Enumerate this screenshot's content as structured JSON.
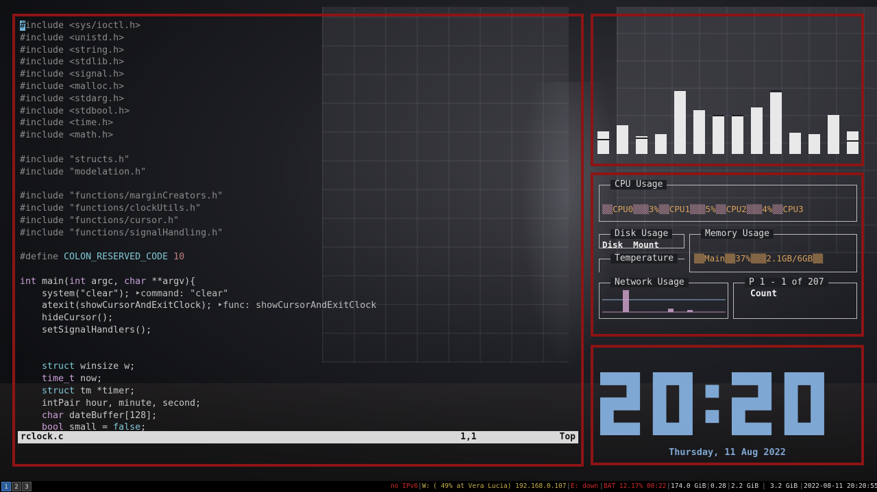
{
  "editor": {
    "lines": [
      [
        [
          "pp",
          "#include <sys/ioctl.h>"
        ]
      ],
      [
        [
          "pp",
          "#include <unistd.h>"
        ]
      ],
      [
        [
          "pp",
          "#include <string.h>"
        ]
      ],
      [
        [
          "pp",
          "#include <stdlib.h>"
        ]
      ],
      [
        [
          "pp",
          "#include <signal.h>"
        ]
      ],
      [
        [
          "pp",
          "#include <malloc.h>"
        ]
      ],
      [
        [
          "pp",
          "#include <stdarg.h>"
        ]
      ],
      [
        [
          "pp",
          "#include <stdbool.h>"
        ]
      ],
      [
        [
          "pp",
          "#include <time.h>"
        ]
      ],
      [
        [
          "pp",
          "#include <math.h>"
        ]
      ],
      [],
      [
        [
          "pp",
          "#include \"structs.h\""
        ]
      ],
      [
        [
          "pp",
          "#include \"modelation.h\""
        ]
      ],
      [],
      [
        [
          "pp",
          "#include \"functions/marginCreators.h\""
        ]
      ],
      [
        [
          "pp",
          "#include \"functions/clockUtils.h\""
        ]
      ],
      [
        [
          "pp",
          "#include \"functions/cursor.h\""
        ]
      ],
      [
        [
          "pp",
          "#include \"functions/signalHandling.h\""
        ]
      ],
      [],
      [
        [
          "pp",
          "#define "
        ],
        [
          "def",
          "COLON_RESERVED_CODE "
        ],
        [
          "num",
          "10"
        ]
      ],
      [],
      [
        [
          "ty",
          "int"
        ],
        [
          "str",
          " main("
        ],
        [
          "ty",
          "int"
        ],
        [
          "str",
          " argc, "
        ],
        [
          "ty",
          "char"
        ],
        [
          "str",
          " **argv){"
        ]
      ],
      [
        [
          "str",
          "    system("
        ],
        [
          "str",
          "\"clear\""
        ],
        [
          "str",
          "); "
        ],
        [
          "hint",
          "‣command: \"clear\""
        ]
      ],
      [
        [
          "str",
          "    atexit(showCursorAndExitClock); "
        ],
        [
          "hint",
          "‣func: showCursorAndExitClock"
        ]
      ],
      [
        [
          "str",
          "    hideCursor();"
        ]
      ],
      [
        [
          "str",
          "    setSignalHandlers();"
        ]
      ],
      [],
      [],
      [
        [
          "kw",
          "    struct"
        ],
        [
          "str",
          " winsize w;"
        ]
      ],
      [
        [
          "ty",
          "    time_t"
        ],
        [
          "str",
          " now;"
        ]
      ],
      [
        [
          "kw",
          "    struct"
        ],
        [
          "str",
          " tm *timer;"
        ]
      ],
      [
        [
          "str",
          "    intPair hour, minute, second;"
        ]
      ],
      [
        [
          "ty",
          "    char"
        ],
        [
          "str",
          " dateBuffer[128];"
        ]
      ],
      [
        [
          "ty",
          "    bool"
        ],
        [
          "str",
          " small = "
        ],
        [
          "kw",
          "false"
        ],
        [
          "str",
          ";"
        ]
      ]
    ],
    "filename": "rclock.c",
    "position": "1,1",
    "scroll": "Top"
  },
  "visualizer": {
    "levels": [
      0.3,
      0.38,
      0.24,
      0.26,
      0.84,
      0.58,
      0.52,
      0.52,
      0.62,
      0.82,
      0.28,
      0.26,
      0.52,
      0.3
    ],
    "caps": [
      0.18,
      null,
      0.2,
      null,
      null,
      null,
      0.5,
      0.5,
      null,
      0.83,
      null,
      null,
      null,
      0.16
    ]
  },
  "monitor": {
    "cpu": {
      "title": "CPU Usage",
      "items": [
        {
          "name": "CPU0",
          "pct": "3%"
        },
        {
          "name": "CPU1",
          "pct": "5%"
        },
        {
          "name": "CPU2",
          "pct": "4%"
        },
        {
          "name": "CPU3",
          "pct": ""
        }
      ]
    },
    "disk": {
      "title": "Disk Usage",
      "col1": "Disk",
      "col2": "Mount"
    },
    "memory": {
      "title": "Memory Usage",
      "line": "▒▒Main▒▒37%▒▒▒2.1GB/6GB▒▒"
    },
    "temperature": {
      "title": "Temperature"
    },
    "network": {
      "title": "Network Usage"
    },
    "processes": {
      "title": "P 1 - 1 of 207",
      "column": "Count"
    }
  },
  "clock": {
    "time": "20:20",
    "date": "Thursday, 11 Aug 2022"
  },
  "bar": {
    "workspaces": [
      "1",
      "2",
      "3"
    ],
    "active_workspace": "1",
    "ipv6": "no IPv6",
    "wifi_label": "W:",
    "wifi": "( 49% at Vera Lucia) 192.168.0.107",
    "eth": "E: down",
    "battery": "BAT 12.17% 00:22",
    "disk": "174.0 GiB",
    "load": "0.28",
    "mem_used": "2.2 GiB",
    "mem_avail": "3.2 GiB",
    "datetime": "2022-08-11 20:20:55"
  },
  "colors": {
    "frame": "#8d1414",
    "clock_digits": "#7fa7d3",
    "cpu_name": "#d9a05a",
    "net_line": "#8fb0d8",
    "net_bar": "#c9a0c8"
  }
}
